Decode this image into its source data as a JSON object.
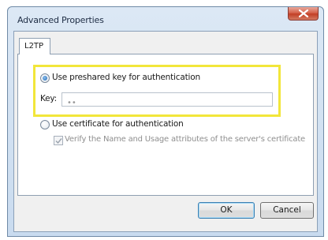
{
  "window": {
    "title": "Advanced Properties"
  },
  "tabs": [
    {
      "label": "L2TP"
    }
  ],
  "options": {
    "preshared": {
      "label": "Use preshared key for authentication",
      "checked": true,
      "key_label": "Key:",
      "key_value": "xx"
    },
    "certificate": {
      "label": "Use certificate for authentication",
      "checked": false,
      "verify_label": "Verify the Name and Usage attributes of the server's certificate",
      "verify_checked": true,
      "verify_disabled": true
    }
  },
  "buttons": {
    "ok": "OK",
    "cancel": "Cancel"
  },
  "colors": {
    "highlight": "#f2e63a",
    "close_button": "#c23f26"
  },
  "icons": {
    "close": "close-icon",
    "check": "checkmark-icon"
  }
}
